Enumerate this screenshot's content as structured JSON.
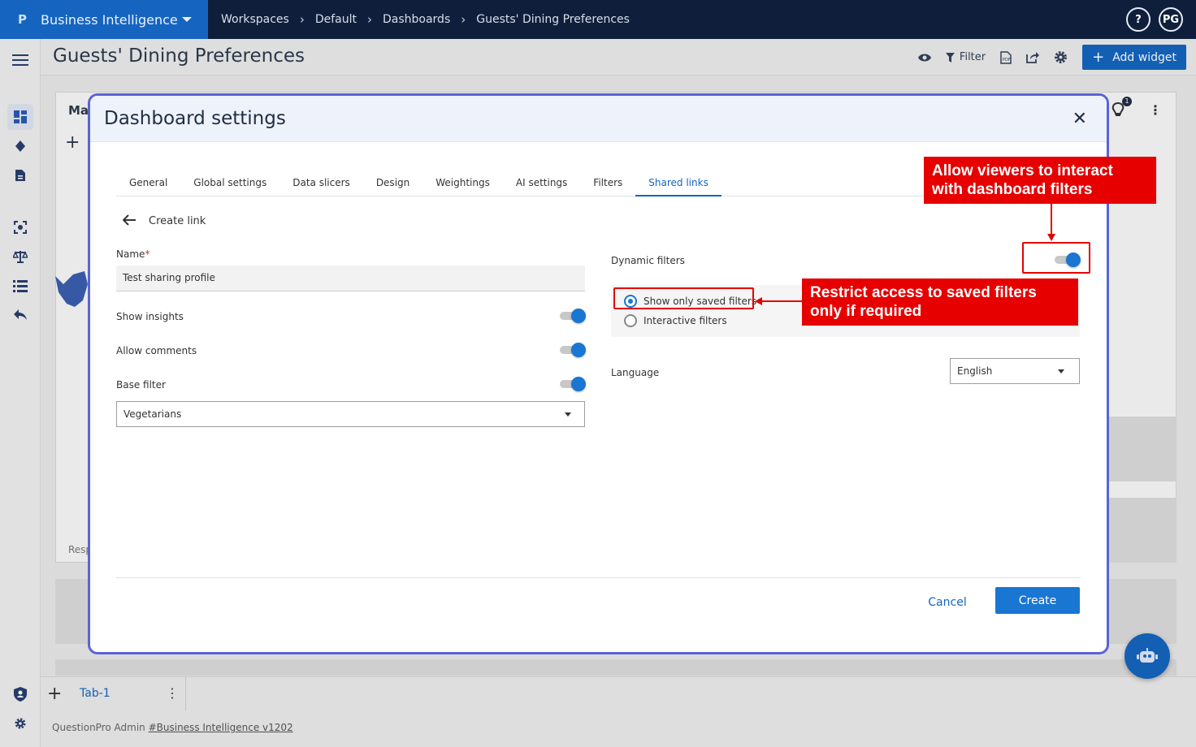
{
  "topbar": {
    "app_logo": "P",
    "app_name": "Business Intelligence",
    "breadcrumbs": [
      "Workspaces",
      "Default",
      "Dashboards",
      "Guests' Dining Preferences"
    ],
    "help": "?",
    "avatar": "PG"
  },
  "page": {
    "title": "Guests' Dining Preferences",
    "filter_label": "Filter",
    "add_widget_label": "Add widget"
  },
  "background": {
    "card_title": "Ma",
    "card_footer": "Resp",
    "notif_count": "1"
  },
  "tabbar": {
    "tab_label": "Tab-1"
  },
  "footer": {
    "prefix": "QuestionPro Admin ",
    "link": "#Business Intelligence v1202"
  },
  "modal": {
    "title": "Dashboard settings",
    "tabs": [
      "General",
      "Global settings",
      "Data slicers",
      "Design",
      "Weightings",
      "AI settings",
      "Filters",
      "Shared links"
    ],
    "active_tab": "Shared links",
    "create_link": "Create link",
    "name_label": "Name",
    "name_required": "*",
    "name_value": "Test sharing profile",
    "show_insights": "Show insights",
    "allow_comments": "Allow comments",
    "base_filter": "Base filter",
    "base_filter_value": "Vegetarians",
    "dynamic_filters": "Dynamic filters",
    "radio_saved": "Show only saved filters",
    "radio_interactive": "Interactive filters",
    "language_label": "Language",
    "language_value": "English",
    "cancel": "Cancel",
    "create": "Create"
  },
  "annotations": {
    "top": "Allow viewers to interact with dashboard filters",
    "middle": "Restrict access to saved filters only if required",
    "color": "#e60000"
  }
}
